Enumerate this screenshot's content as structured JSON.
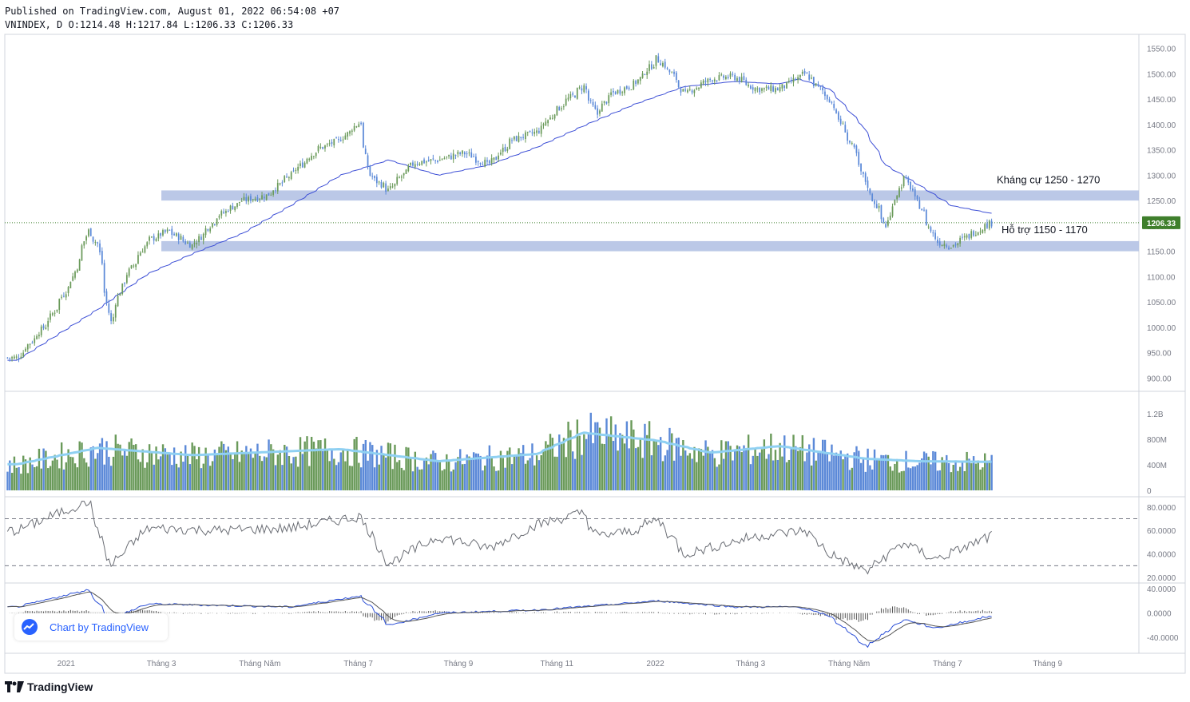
{
  "header": {
    "published": "Published on TradingView.com, August 01, 2022 06:54:08 +07",
    "ohlc": "VNINDEX, D O:1214.48 H:1217.84 L:1206.33 C:1206.33"
  },
  "watermark": {
    "label": "Chart by TradingView",
    "icon": "tradingview-cloud-icon"
  },
  "branding": {
    "label": "TradingView",
    "icon": "tradingview-logo-icon"
  },
  "colors": {
    "up": "#6a9a5a",
    "down": "#5b89d8",
    "zone": "#b7c5e6",
    "ma": "#3d4fd6",
    "vol_ma": "#8fd0f2",
    "price_badge": "#3f7f2c"
  },
  "chart_data": [
    {
      "type": "candlestick",
      "title": "VNINDEX, D",
      "x_tick_labels": [
        "2021",
        "Tháng 3",
        "Tháng Năm",
        "Tháng 7",
        "Tháng 9",
        "Tháng 11",
        "2022",
        "Tháng 3",
        "Tháng Năm",
        "Tháng 7",
        "Tháng 9"
      ],
      "y_tick_labels": [
        "1550.00",
        "1500.00",
        "1450.00",
        "1400.00",
        "1350.00",
        "1300.00",
        "1250.00",
        "1200.00",
        "1150.00",
        "1100.00",
        "1050.00",
        "1000.00",
        "950.00",
        "900.00"
      ],
      "ylim": [
        880,
        1570
      ],
      "last_price": 1206.33,
      "last_price_label": "1206.33",
      "close_path": {
        "x": [
          "2020-12-01",
          "2020-12-20",
          "2021-01-05",
          "2021-01-14",
          "2021-01-20",
          "2021-01-28",
          "2021-02-05",
          "2021-02-20",
          "2021-03-05",
          "2021-03-20",
          "2021-04-05",
          "2021-04-20",
          "2021-05-05",
          "2021-05-20",
          "2021-06-05",
          "2021-06-20",
          "2021-07-02",
          "2021-07-08",
          "2021-07-20",
          "2021-08-05",
          "2021-08-20",
          "2021-09-05",
          "2021-09-20",
          "2021-10-05",
          "2021-10-20",
          "2021-11-05",
          "2021-11-18",
          "2021-11-26",
          "2021-12-05",
          "2021-12-20",
          "2022-01-03",
          "2022-01-12",
          "2022-01-20",
          "2022-02-05",
          "2022-02-20",
          "2022-03-05",
          "2022-03-20",
          "2022-04-05",
          "2022-04-20",
          "2022-05-05",
          "2022-05-13",
          "2022-05-25",
          "2022-06-05",
          "2022-06-15",
          "2022-06-25",
          "2022-07-05",
          "2022-07-15",
          "2022-07-29"
        ],
        "y": [
          940,
          1010,
          1100,
          1190,
          1165,
          1010,
          1090,
          1170,
          1190,
          1160,
          1220,
          1250,
          1260,
          1300,
          1350,
          1370,
          1405,
          1300,
          1270,
          1325,
          1330,
          1345,
          1320,
          1370,
          1385,
          1440,
          1475,
          1420,
          1460,
          1480,
          1530,
          1500,
          1460,
          1490,
          1495,
          1470,
          1470,
          1500,
          1450,
          1350,
          1280,
          1200,
          1300,
          1240,
          1170,
          1160,
          1180,
          1206
        ]
      },
      "ma": {
        "x": [
          "2020-12-01",
          "2021-01-20",
          "2021-02-20",
          "2021-03-20",
          "2021-04-20",
          "2021-05-20",
          "2021-06-20",
          "2021-07-20",
          "2021-08-20",
          "2021-09-20",
          "2021-10-20",
          "2021-11-20",
          "2021-12-20",
          "2022-01-20",
          "2022-02-20",
          "2022-03-20",
          "2022-04-01",
          "2022-04-20",
          "2022-05-10",
          "2022-05-25",
          "2022-06-15",
          "2022-07-05",
          "2022-07-29"
        ],
        "y": [
          935,
          1035,
          1105,
          1145,
          1185,
          1240,
          1300,
          1330,
          1300,
          1320,
          1355,
          1400,
          1440,
          1475,
          1485,
          1480,
          1490,
          1470,
          1400,
          1320,
          1280,
          1240,
          1225
        ]
      },
      "zones": [
        {
          "label": "Kháng cự 1250 - 1270",
          "low": 1250,
          "high": 1270,
          "from": "2021-03-01"
        },
        {
          "label": "Hỗ trợ 1150 - 1170",
          "low": 1150,
          "high": 1170,
          "from": "2021-03-01"
        }
      ]
    },
    {
      "type": "bar",
      "title": "Volume",
      "y_tick_labels": [
        "1.2B",
        "800M",
        "400M",
        "0"
      ],
      "ylim": [
        0,
        1500000000
      ],
      "volume_path": {
        "x": [
          "2020-12-01",
          "2021-01-20",
          "2021-03-20",
          "2021-06-20",
          "2021-08-20",
          "2021-10-20",
          "2021-11-18",
          "2022-01-03",
          "2022-02-05",
          "2022-03-20",
          "2022-05-13",
          "2022-06-15",
          "2022-07-29"
        ],
        "y": [
          430000000,
          700000000,
          580000000,
          680000000,
          480000000,
          600000000,
          950000000,
          820000000,
          620000000,
          730000000,
          520000000,
          480000000,
          470000000
        ]
      }
    },
    {
      "type": "line",
      "title": "RSI",
      "y_tick_labels": [
        "80.0000",
        "60.0000",
        "40.0000",
        "20.0000"
      ],
      "ylim": [
        18,
        86
      ],
      "bands": [
        70,
        30
      ],
      "rsi_path": {
        "x": [
          "2020-12-01",
          "2021-01-14",
          "2021-01-28",
          "2021-02-20",
          "2021-04-05",
          "2021-05-20",
          "2021-07-02",
          "2021-07-20",
          "2021-08-20",
          "2021-09-20",
          "2021-10-20",
          "2021-11-18",
          "2021-11-26",
          "2021-12-20",
          "2022-01-03",
          "2022-01-20",
          "2022-03-05",
          "2022-04-05",
          "2022-04-20",
          "2022-05-13",
          "2022-06-05",
          "2022-06-25",
          "2022-07-29"
        ],
        "y": [
          60,
          85,
          30,
          62,
          60,
          62,
          72,
          32,
          55,
          45,
          65,
          75,
          55,
          60,
          70,
          40,
          55,
          60,
          40,
          25,
          50,
          35,
          55
        ]
      }
    },
    {
      "type": "line",
      "title": "MACD",
      "y_tick_labels": [
        "40.0000",
        "0.0000",
        "-40.0000"
      ],
      "ylim": [
        -62,
        44
      ],
      "macd_path": {
        "x": [
          "2020-12-01",
          "2021-01-14",
          "2021-01-28",
          "2021-02-20",
          "2021-05-20",
          "2021-07-02",
          "2021-07-20",
          "2021-08-20",
          "2021-10-20",
          "2021-11-26",
          "2022-01-03",
          "2022-02-20",
          "2022-04-01",
          "2022-04-20",
          "2022-05-13",
          "2022-06-05",
          "2022-06-25",
          "2022-07-29"
        ],
        "y": [
          10,
          38,
          -10,
          15,
          10,
          28,
          -20,
          0,
          5,
          12,
          20,
          10,
          10,
          -5,
          -55,
          -10,
          -25,
          -5
        ]
      }
    }
  ]
}
